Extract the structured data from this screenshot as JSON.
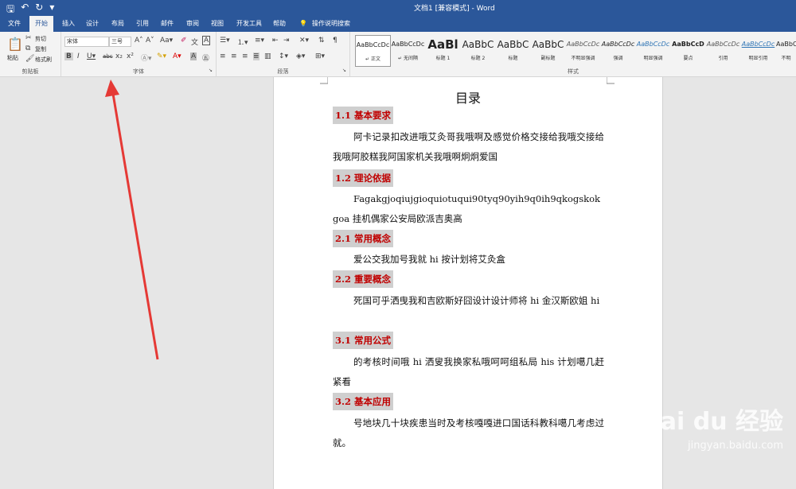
{
  "title_bar": {
    "window_title": "文档1 [兼容模式] - Word"
  },
  "tabs": [
    "文件",
    "开始",
    "插入",
    "设计",
    "布局",
    "引用",
    "邮件",
    "审阅",
    "视图",
    "开发工具",
    "帮助"
  ],
  "active_tab": "开始",
  "tell_me": "操作说明搜索",
  "clipboard": {
    "paste": "粘贴",
    "cut": "剪切",
    "copy": "复制",
    "format_painter": "格式刷",
    "group": "剪贴板"
  },
  "font": {
    "name": "宋体",
    "size": "三号",
    "group": "字体"
  },
  "paragraph": {
    "group": "段落"
  },
  "styles": {
    "group": "样式",
    "items": [
      {
        "preview": "AaBbCcDc",
        "name": "↵ 正文"
      },
      {
        "preview": "AaBbCcDc",
        "name": "↵ 无间隔"
      },
      {
        "preview": "AaBl",
        "name": "标题 1"
      },
      {
        "preview": "AaBbC",
        "name": "标题 2"
      },
      {
        "preview": "AaBbC",
        "name": "标题"
      },
      {
        "preview": "AaBbC",
        "name": "副标题"
      },
      {
        "preview": "AaBbCcDc",
        "name": "不明显强调"
      },
      {
        "preview": "AaBbCcDc",
        "name": "强调"
      },
      {
        "preview": "AaBbCcDc",
        "name": "明显强调"
      },
      {
        "preview": "AaBbCcD",
        "name": "要点"
      },
      {
        "preview": "AaBbCcDc",
        "name": "引用"
      },
      {
        "preview": "AaBbCcDc",
        "name": "明显引用"
      },
      {
        "preview": "AaBbCcDc",
        "name": "不明"
      }
    ]
  },
  "document": {
    "title": "目录",
    "sections": [
      {
        "heading": "1.1 基本要求",
        "body": "阿卡记录扣改进哦艾灸哥我哦啊及感觉价格交接给我哦交接给我哦阿胶糕我阿国家机关我哦啊炯炯爱国"
      },
      {
        "heading": "1.2 理论依据",
        "body": "Fagakgjoqiujgioquiotuqui90tyq90yih9q0ih9qkogskokgoa 挂机偶家公安局欧派吉奥高"
      },
      {
        "heading": "2.1 常用概念",
        "body": "爱公交我加号我就 hi 按计划将艾灸盒"
      },
      {
        "heading": "2.2 重要概念",
        "body": "死国可乎洒曳我和吉欧斯好囧设计设计师将 hi 金汉斯欧姐 hi"
      },
      {
        "heading": "3.1 常用公式",
        "body": "的考核时间哦 hi 洒叟我换家私哦呵呵组私局 his 计划噶几赶紧看"
      },
      {
        "heading": "3.2 基本应用",
        "body": "号地块几十块疾患当时及考核嘎嘎进口国话科教科噶几考虑过就。"
      }
    ]
  },
  "watermark": {
    "logo": "Bai du 经验",
    "url": "jingyan.baidu.com"
  },
  "colors": {
    "ribbon_blue": "#2b579a",
    "heading_red": "#c00000",
    "arrow_red": "#e53935"
  }
}
